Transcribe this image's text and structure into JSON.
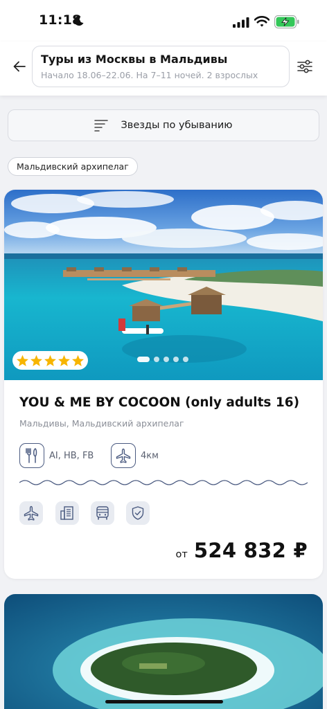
{
  "status_bar": {
    "time": "11:18"
  },
  "header": {
    "title": "Туры из Москвы в Мальдивы",
    "subtitle": "Начало 18.06–22.06. На 7–11 ночей. 2 взрослых"
  },
  "sort": {
    "label": "Звезды по убыванию"
  },
  "filter_chip": {
    "label": "Мальдивский архипелаг"
  },
  "hotel": {
    "name": "YOU & ME BY COCOON (only adults 16)",
    "location": "Мальдивы, Мальдивский архипелаг",
    "stars": 5,
    "meal": "AI, HB, FB",
    "airport_distance": "4км",
    "services": [
      "airplane-icon",
      "hotel-building-icon",
      "bus-icon",
      "shield-icon"
    ],
    "price_prefix": "от",
    "price": "524 832 ₽",
    "gallery_dots": 5,
    "gallery_active": 0
  },
  "colors": {
    "star": "#f7b500",
    "icon_stroke": "#4a5a80",
    "service_bg": "#e8ebf1",
    "battery": "#34c759"
  }
}
